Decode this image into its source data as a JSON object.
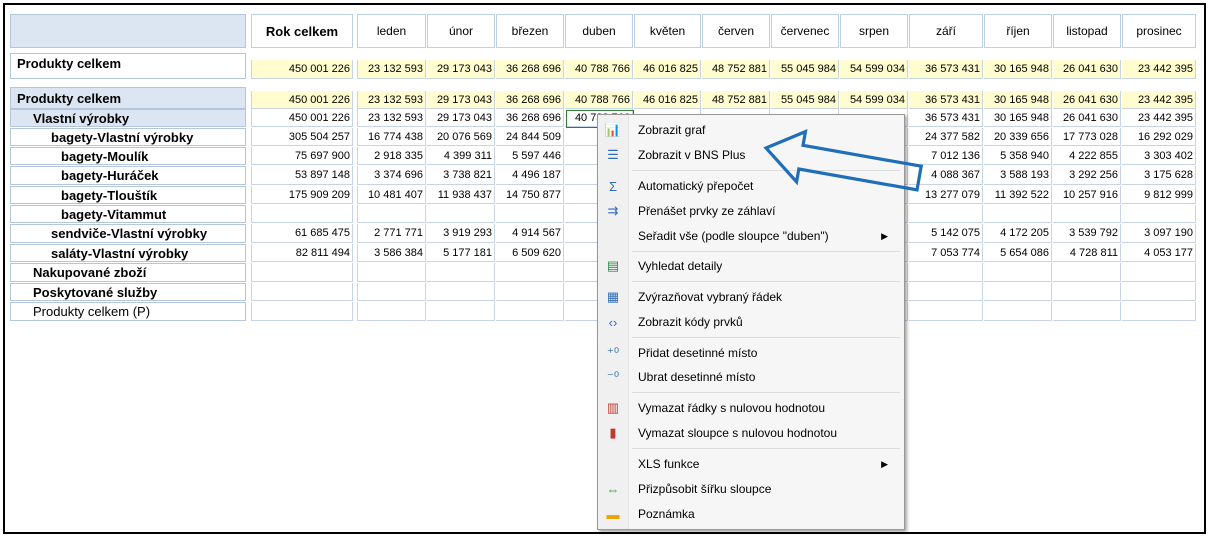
{
  "header": {
    "total_label": "Rok celkem",
    "months": [
      "leden",
      "únor",
      "březen",
      "duben",
      "květen",
      "červen",
      "červenec",
      "srpen",
      "září",
      "říjen",
      "listopad",
      "prosinec"
    ]
  },
  "summary_row": {
    "label": "Produkty celkem",
    "values": [
      "450 001 226",
      "23 132 593",
      "29 173 043",
      "36 268 696",
      "40 788 766",
      "46 016 825",
      "48 752 881",
      "55 045 984",
      "54 599 034",
      "36 573 431",
      "30 165 948",
      "26 041 630",
      "23 442 395"
    ]
  },
  "rows": [
    {
      "label": "Produkty celkem",
      "values": [
        "450 001 226",
        "23 132 593",
        "29 173 043",
        "36 268 696",
        "40 788 766",
        "46 016 825",
        "48 752 881",
        "55 045 984",
        "54 599 034",
        "36 573 431",
        "30 165 948",
        "26 041 630",
        "23 442 395"
      ]
    },
    {
      "label": "Vlastní výrobky",
      "values": [
        "450 001 226",
        "23 132 593",
        "29 173 043",
        "36 268 696",
        "40 788 766",
        "",
        "",
        "",
        "",
        "36 573 431",
        "30 165 948",
        "26 041 630",
        "23 442 395"
      ]
    },
    {
      "label": "bagety-Vlastní výrobky",
      "values": [
        "305 504 257",
        "16 774 438",
        "20 076 569",
        "24 844 509",
        "27 88",
        "",
        "",
        "",
        "",
        "24 377 582",
        "20 339 656",
        "17 773 028",
        "16 292 029"
      ]
    },
    {
      "label": "bagety-Moulík",
      "values": [
        "75 697 900",
        "2 918 335",
        "4 399 311",
        "5 597 446",
        "6 3",
        "",
        "",
        "",
        "",
        "7 012 136",
        "5 358 940",
        "4 222 855",
        "3 303 402"
      ]
    },
    {
      "label": "bagety-Huráček",
      "values": [
        "53 897 148",
        "3 374 696",
        "3 738 821",
        "4 496 187",
        "4 9",
        "",
        "",
        "",
        "",
        "4 088 367",
        "3 588 193",
        "3 292 256",
        "3 175 628"
      ]
    },
    {
      "label": "bagety-Tlouštík",
      "values": [
        "175 909 209",
        "10 481 407",
        "11 938 437",
        "14 750 877",
        "16 5",
        "",
        "",
        "",
        "",
        "13 277 079",
        "11 392 522",
        "10 257 916",
        "9 812 999"
      ]
    },
    {
      "label": "bagety-Vitammut",
      "values": [
        "",
        "",
        "",
        "",
        "",
        "",
        "",
        "",
        "",
        "",
        "",
        "",
        ""
      ]
    },
    {
      "label": "sendviče-Vlastní výrobky",
      "values": [
        "61 685 475",
        "2 771 771",
        "3 919 293",
        "4 914 567",
        "5 5",
        "",
        "",
        "",
        "",
        "5 142 075",
        "4 172 205",
        "3 539 792",
        "3 097 190"
      ]
    },
    {
      "label": "saláty-Vlastní výrobky",
      "values": [
        "82 811 494",
        "3 586 384",
        "5 177 181",
        "6 509 620",
        "7 3",
        "",
        "",
        "",
        "",
        "7 053 774",
        "5 654 086",
        "4 728 811",
        "4 053 177"
      ]
    },
    {
      "label": "Nakupované zboží",
      "values": [
        "",
        "",
        "",
        "",
        "",
        "",
        "",
        "",
        "",
        "",
        "",
        "",
        ""
      ]
    },
    {
      "label": "Poskytované služby",
      "values": [
        "",
        "",
        "",
        "",
        "",
        "",
        "",
        "",
        "",
        "",
        "",
        "",
        ""
      ]
    },
    {
      "label": "Produkty celkem (P)",
      "values": [
        "",
        "",
        "",
        "",
        "",
        "",
        "",
        "",
        "",
        "",
        "",
        "",
        ""
      ]
    }
  ],
  "context_menu": {
    "items": [
      {
        "label": "Zobrazit graf",
        "icon": "chart-icon"
      },
      {
        "label": "Zobrazit v BNS Plus",
        "icon": "list-icon"
      },
      {
        "label": "Automatický přepočet",
        "icon": "sigma-icon"
      },
      {
        "label": "Přenášet prvky ze záhlaví",
        "icon": "transfer-icon"
      },
      {
        "label": "Seřadit vše (podle sloupce \"duben\")",
        "icon": "",
        "submenu": true
      },
      {
        "label": "Vyhledat detaily",
        "icon": "search-details-icon"
      },
      {
        "label": "Zvýrazňovat vybraný řádek",
        "icon": "highlight-row-icon"
      },
      {
        "label": "Zobrazit kódy prvků",
        "icon": "code-icon"
      },
      {
        "label": "Přidat desetinné místo",
        "icon": "add-decimal-icon"
      },
      {
        "label": "Ubrat desetinné místo",
        "icon": "remove-decimal-icon"
      },
      {
        "label": "Vymazat řádky s nulovou hodnotou",
        "icon": "delete-rows-icon"
      },
      {
        "label": "Vymazat sloupce s nulovou hodnotou",
        "icon": "delete-columns-icon"
      },
      {
        "label": "XLS funkce",
        "icon": "",
        "submenu": true
      },
      {
        "label": "Přizpůsobit šířku sloupce",
        "icon": "fit-width-icon"
      },
      {
        "label": "Poznámka",
        "icon": "note-icon"
      }
    ]
  },
  "colors": {
    "header_blue": "#dce6f2",
    "summary_yellow": "#fffdcf",
    "arrow_blue": "#1f6fb8"
  }
}
